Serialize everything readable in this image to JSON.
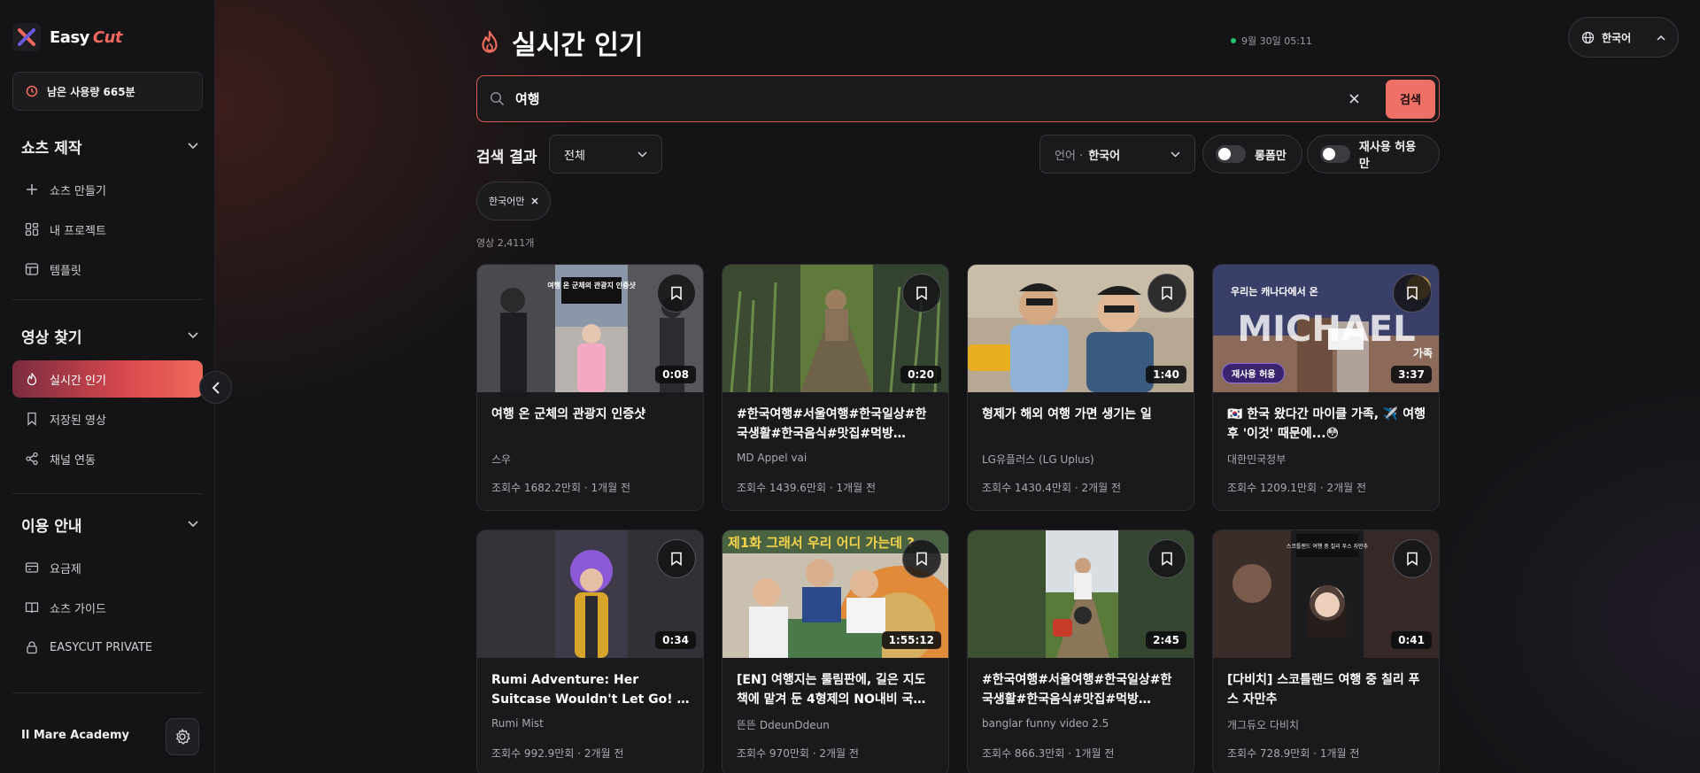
{
  "app": {
    "logo_primary": "Easy",
    "logo_accent": "Cut"
  },
  "usage": {
    "label": "남은 사용량 665분"
  },
  "sidebar": {
    "sections": [
      {
        "title": "쇼츠 제작",
        "items": [
          {
            "label": "쇼츠 만들기",
            "icon": "plus-icon"
          },
          {
            "label": "내 프로젝트",
            "icon": "grid-icon"
          },
          {
            "label": "템플릿",
            "icon": "template-icon"
          }
        ]
      },
      {
        "title": "영상 찾기",
        "items": [
          {
            "label": "실시간 인기",
            "icon": "flame-icon",
            "active": true
          },
          {
            "label": "저장된 영상",
            "icon": "bookmark-icon"
          },
          {
            "label": "채널 연동",
            "icon": "share-icon"
          }
        ]
      },
      {
        "title": "이용 안내",
        "items": [
          {
            "label": "요금제",
            "icon": "card-icon"
          },
          {
            "label": "쇼츠 가이드",
            "icon": "book-icon"
          },
          {
            "label": "EASYCUT PRIVATE",
            "icon": "lock-icon"
          }
        ]
      }
    ],
    "user_name": "Il Mare Academy"
  },
  "header": {
    "title": "실시간 인기",
    "timestamp": "9월 30일 05:11",
    "language": "한국어"
  },
  "search": {
    "value": "여행",
    "button": "검색"
  },
  "filters": {
    "results_label": "검색 결과",
    "category": "전체",
    "language_prefix": "언어 ·",
    "language_value": "한국어",
    "toggle_long": "롱폼만",
    "toggle_reuse": "재사용 허용만",
    "chip": "한국어만",
    "count": "영상 2,411개"
  },
  "colors": {
    "accent": "#ee7067",
    "active_gradient_end": "#ee6a5a",
    "status_dot": "#23c26b",
    "reuse_badge": "#3a2470"
  },
  "videos": [
    {
      "title": "여행 온 군체의 관광지 인증샷",
      "channel": "스우",
      "views": "조회수 1682.2만회",
      "age": "1개월 전",
      "duration": "0:08",
      "thumb_text": "여행 온 군체의 관광지 인증샷"
    },
    {
      "title": "#한국여행#서울여행#한국일상#한국생활#한국음식#맛집#먹방#KPOP...",
      "channel": "MD Appel vai",
      "views": "조회수 1439.6만회",
      "age": "1개월 전",
      "duration": "0:20"
    },
    {
      "title": "형제가 해외 여행 가면 생기는 일",
      "channel": "LG유플러스 (LG Uplus)",
      "views": "조회수 1430.4만회",
      "age": "2개월 전",
      "duration": "1:40"
    },
    {
      "title": "🇰🇷 한국 왔다간 마이클 가족, ✈️ 여행 후 '이것' 때문에...😳",
      "channel": "대한민국정부",
      "views": "조회수 1209.1만회",
      "age": "2개월 전",
      "duration": "3:37",
      "badge": "재사용 허용",
      "thumb_text": "우리는 캐나다에서 온",
      "thumb_big": "MICHAEL",
      "thumb_small": "가족"
    },
    {
      "title": "Rumi Adventure: Her Suitcase Wouldn't Let Go! | 여행 가방에 ...",
      "channel": "Rumi Mist",
      "views": "조회수 992.9만회",
      "age": "2개월 전",
      "duration": "0:34"
    },
    {
      "title": "[EN] 여행지는 룰림판에, 길은 지도책에 맡겨 둔 4형제의 NO내비 국도 여...",
      "channel": "뜬뜬 DdeunDdeun",
      "views": "조회수 970만회",
      "age": "2개월 전",
      "duration": "1:55:12",
      "thumb_text": "제1화 그래서 우리 어디 가는데 ?"
    },
    {
      "title": "#한국여행#서울여행#한국일상#한국생활#한국음식#맛집#먹방#KPOP...",
      "channel": "banglar funny video 2.5",
      "views": "조회수 866.3만회",
      "age": "1개월 전",
      "duration": "2:45"
    },
    {
      "title": "[다비치] 스코틀랜드 여행 중 칠리 푸스 자만추",
      "channel": "개그듀오 다비치",
      "views": "조회수 728.9만회",
      "age": "1개월 전",
      "duration": "0:41",
      "thumb_text": "스코틀랜드 여행 중 칠리 푸스 자만추"
    }
  ]
}
